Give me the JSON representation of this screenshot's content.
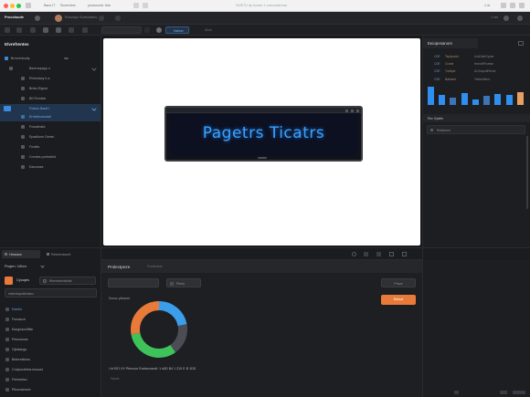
{
  "titlebar": {
    "app_name": "Procoloude",
    "tab1": "Bano i7",
    "tab2": "Scoreview",
    "tab3": "yoursound. leta",
    "center": "SWETU dp hocstn 1 cokcewatrmat",
    "right": "1 ot"
  },
  "header": {
    "brand": "Procoloude",
    "user": "Etrsvapo Surtuidaelo",
    "right": "1 iun"
  },
  "toolbar": {
    "field1": "",
    "active": "Nsbesr",
    "extra": "Nhve"
  },
  "sidebar": {
    "title": "Elvrefrentes",
    "items": [
      {
        "label": "Brrnvertoudy",
        "level": 0
      },
      {
        "label": "Bsrerarpapp n",
        "level": 1
      },
      {
        "label": "Rhrtnrdwy b a",
        "level": 2
      },
      {
        "label": "Brisls Elgrnd",
        "level": 2
      },
      {
        "label": "B0 Rcrnttar",
        "level": 2
      },
      {
        "label": "Fraecs Baofrt",
        "level": 1,
        "selected": true
      },
      {
        "label": "Ernbttouraniatt",
        "level": 2,
        "selected": true
      },
      {
        "label": "Fraxarbata",
        "level": 2
      },
      {
        "label": "Epastlunn Gsesn",
        "level": 2
      },
      {
        "label": "Fnratts",
        "level": 2
      },
      {
        "label": "Cnrotes portrrdeid",
        "level": 2
      },
      {
        "label": "Eaecssse",
        "level": 2
      }
    ]
  },
  "canvas": {
    "banner_text": "Pagetrs Ticatrs"
  },
  "rpanel": {
    "title": "Eeiopesanore",
    "rows": [
      {
        "k": "C0E",
        "v": "Tsrptpaiet",
        "v2": "UrsDidbOyear"
      },
      {
        "k": "C0E",
        "v": "Cicbie",
        "v2": "tmvclrtPicetse"
      },
      {
        "k": "C0E",
        "v": "Tralhpe",
        "v2": "AUCapuitRsrne"
      },
      {
        "k": "C0E",
        "v": "Balloere",
        "v2": "Tettsmfliere"
      }
    ],
    "bars": [
      {
        "value": 18,
        "color": "#2f8ff0"
      },
      {
        "value": 10,
        "color": "#2f8ff0"
      },
      {
        "value": 7,
        "color": "#3e73b5"
      },
      {
        "value": 12,
        "color": "#2f8ff0"
      },
      {
        "value": 5,
        "color": "#2f8ff0"
      },
      {
        "value": 9,
        "color": "#3e73b5"
      },
      {
        "value": 11,
        "color": "#2f8ff0"
      },
      {
        "value": 10,
        "color": "#2f8ff0"
      },
      {
        "value": 13,
        "color": "#e8a060"
      }
    ],
    "section": "Rer Gplele",
    "section_item": "Rmtetorni"
  },
  "bottom_left": {
    "tab1": "Hessaon",
    "tab2": "Rebeeossurtt",
    "project_label": "Projen: 10hm",
    "profile_name": "Cjnoqes",
    "profile_sub": "Rrtentresemtcslle",
    "search": "edotrnkopaticfutanz",
    "items": [
      {
        "label": "Estetrs",
        "blue": true
      },
      {
        "label": "Fsrnasch",
        "blue": false
      },
      {
        "label": "Eaxgnaovifitile",
        "blue": false
      },
      {
        "label": "Pesxonnss",
        "blue": false
      },
      {
        "label": "Ojtnkangs",
        "blue": false
      },
      {
        "label": "Bnterestions",
        "blue": false
      },
      {
        "label": "Cncipsclettos lusoust",
        "blue": false
      },
      {
        "label": "Fleirmeiso",
        "blue": false
      },
      {
        "label": "Pitcoxiarmce",
        "blue": false
      }
    ]
  },
  "bottom_main": {
    "title": "Prolectpeze",
    "subtitle": "Fsvtteiane",
    "btn1": "",
    "btn2": "Ptmis",
    "section_label": "Socsc ytlosoer",
    "ghost_btn": "Prsce",
    "orange_btn": "Bstsaf",
    "donut_segments": [
      {
        "value": 22,
        "color": "#3a9eea"
      },
      {
        "value": 18,
        "color": "#4a4d53"
      },
      {
        "value": 32,
        "color": "#3ec35a"
      },
      {
        "value": 28,
        "color": "#e87a3a"
      }
    ],
    "footer": "I ht ElO VV Ptrecoor Ecetsnosedt:   1 d4D B4   1 Z10 E  B 1DD",
    "footer2": "Fsrcdc"
  }
}
